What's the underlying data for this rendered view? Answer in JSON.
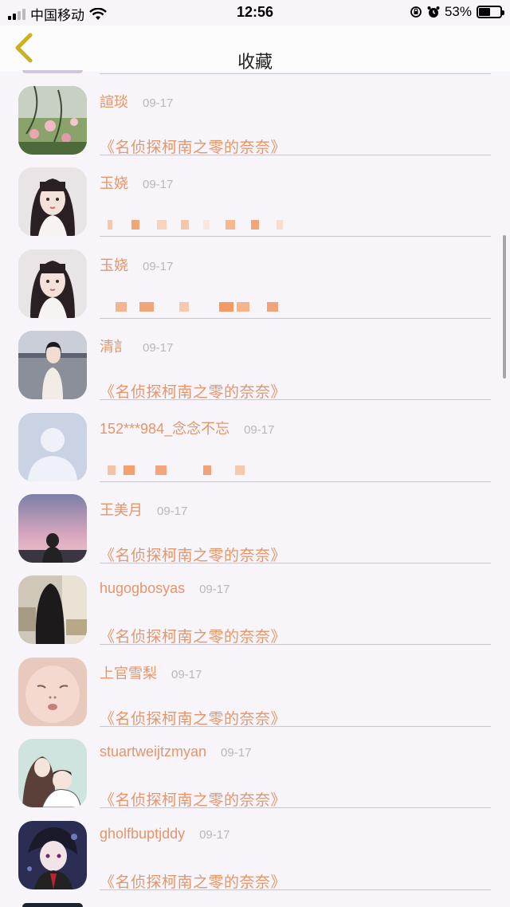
{
  "status_bar": {
    "carrier": "中国移动",
    "time": "12:56",
    "battery_percent": "53%",
    "battery_level": 0.53
  },
  "nav": {
    "title": "收藏",
    "back_icon": "chevron-left-icon"
  },
  "items": [
    {
      "name": "諠琰",
      "date": "09-17",
      "content": "《名侦探柯南之零的奈奈》",
      "avatar": "roses-photo"
    },
    {
      "name": "玉娆",
      "date": "09-17",
      "content": "",
      "avatar": "girl-portrait"
    },
    {
      "name": "玉娆",
      "date": "09-17",
      "content": "",
      "avatar": "girl-portrait"
    },
    {
      "name": "清訁",
      "date": "09-17",
      "content": "《名侦探柯南之零的奈奈》",
      "avatar": "beach-girl"
    },
    {
      "name": "152***984_念念不忘",
      "date": "09-17",
      "content": "",
      "avatar": "default-avatar"
    },
    {
      "name": "王美月",
      "date": "09-17",
      "content": "《名侦探柯南之零的奈奈》",
      "avatar": "sunset-silhouette"
    },
    {
      "name": "hugogbosyas",
      "date": "09-17",
      "content": "《名侦探柯南之零的奈奈》",
      "avatar": "longhair-girl"
    },
    {
      "name": "上官雪梨",
      "date": "09-17",
      "content": "《名侦探柯南之零的奈奈》",
      "avatar": "baby-face"
    },
    {
      "name": "stuartweijtzmyan",
      "date": "09-17",
      "content": "《名侦探柯南之零的奈奈》",
      "avatar": "illustration-couple"
    },
    {
      "name": "gholfbuptjddy",
      "date": "09-17",
      "content": "《名侦探柯南之零的奈奈》",
      "avatar": "anime-boy"
    }
  ],
  "colors": {
    "accent": "#e6956a",
    "date": "#b9b6bd",
    "back_icon": "#c9b21e"
  }
}
